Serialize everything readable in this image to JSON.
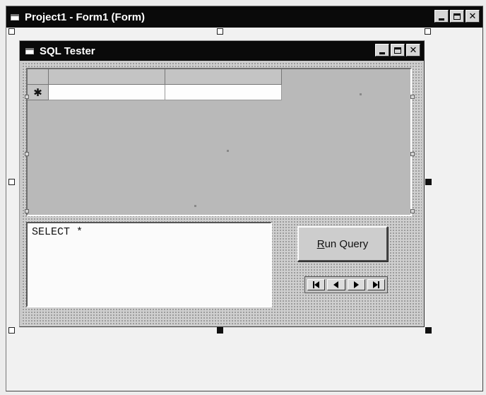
{
  "outer_window": {
    "title": "Project1 - Form1 (Form)",
    "icon": "form-icon"
  },
  "inner_window": {
    "title": "SQL Tester",
    "icon": "form-icon"
  },
  "grid": {
    "new_row_marker": "✱",
    "columns": [
      "",
      ""
    ]
  },
  "sql_textbox": {
    "value": "SELECT *"
  },
  "run_query_button": {
    "label_accel": "R",
    "label_rest": "un Query"
  },
  "navigation": {
    "icons": [
      "first-record-icon",
      "previous-record-icon",
      "next-record-icon",
      "last-record-icon"
    ]
  },
  "window_controls": {
    "icons": [
      "minimize-icon",
      "maximize-icon",
      "close-icon"
    ],
    "close_glyph": "✕"
  },
  "colors": {
    "titlebar": "#0a0a0a",
    "face": "#c9c9c9"
  }
}
